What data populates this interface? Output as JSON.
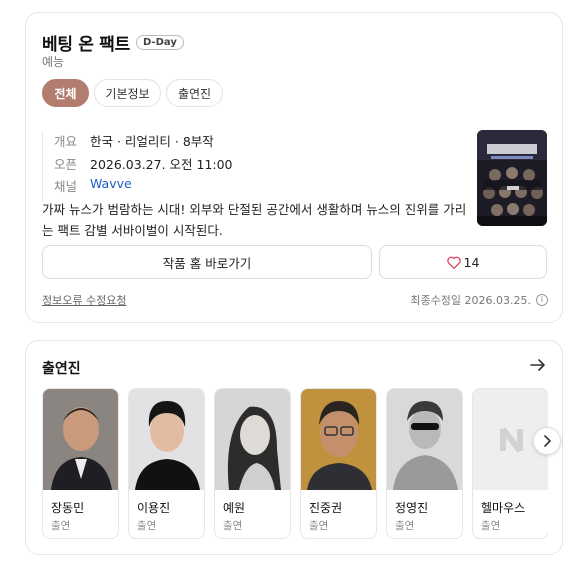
{
  "header": {
    "title": "베팅 온 팩트",
    "badge": "D-Day",
    "genre": "예능"
  },
  "tabs": [
    {
      "label": "전체",
      "active": true
    },
    {
      "label": "기본정보",
      "active": false
    },
    {
      "label": "출연진",
      "active": false
    }
  ],
  "info": {
    "overview_key": "개요",
    "overview_value": "한국 · 리얼리티 · 8부작",
    "open_key": "오픈",
    "open_value": "2026.03.27. 오전 11:00",
    "channel_key": "채널",
    "channel_value": "Wavve"
  },
  "description": "가짜 뉴스가 범람하는 시대! 외부와 단절된 공간에서 생활하며 뉴스의 진위를 가리는 팩트 감별 서바이벌이 시작된다.",
  "actions": {
    "home_label": "작품 홈 바로가기",
    "like_count": "14"
  },
  "footer": {
    "report_label": "정보오류 수정요청",
    "modified_label": "최종수정일 2026.03.25."
  },
  "cast_section": {
    "title": "출연진",
    "members": [
      {
        "name": "장동민",
        "role": "출연"
      },
      {
        "name": "이용진",
        "role": "출연"
      },
      {
        "name": "예원",
        "role": "출연"
      },
      {
        "name": "진중권",
        "role": "출연"
      },
      {
        "name": "정영진",
        "role": "출연"
      },
      {
        "name": "헬마우스",
        "role": "출연"
      }
    ]
  },
  "colors": {
    "active_tab": "#b27c6f",
    "link": "#1d5fc5",
    "heart": "#e0405a"
  },
  "icons": [
    "heart-icon",
    "info-icon",
    "arrow-right-icon",
    "chevron-right-icon",
    "placeholder-n-icon"
  ]
}
